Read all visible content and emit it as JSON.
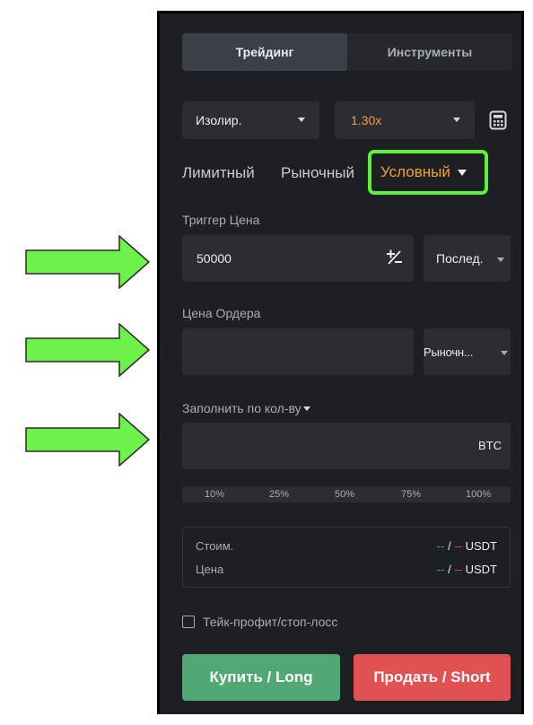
{
  "tabs": {
    "trading": "Трейдинг",
    "tools": "Инструменты"
  },
  "margin_mode": {
    "label": "Изолир."
  },
  "leverage": {
    "value": "1.30x"
  },
  "order_types": {
    "limit": "Лимитный",
    "market": "Рыночный",
    "conditional": "Условный"
  },
  "trigger": {
    "label": "Триггер Цена",
    "value": "50000",
    "type": "Послед."
  },
  "order_price": {
    "label": "Цена Ордера",
    "value": "",
    "type": "Рыночн..."
  },
  "fill": {
    "label": "Заполнить по кол-ву",
    "unit": "BTC"
  },
  "percent_marks": [
    "10%",
    "25%",
    "50%",
    "75%",
    "100%"
  ],
  "summary": {
    "cost_label": "Стоим.",
    "price_label": "Цена",
    "dash": "--",
    "sep": "/",
    "unit": "USDT"
  },
  "tpsl": {
    "label": "Тейк-профит/стоп-лосс",
    "checked": false
  },
  "buttons": {
    "buy": "Купить / Long",
    "sell": "Продать / Short"
  },
  "colors": {
    "accent": "#f0a030",
    "buy": "#52a874",
    "sell": "#e05252",
    "highlight": "#5cf23a",
    "arrow": "#6cf24a"
  }
}
